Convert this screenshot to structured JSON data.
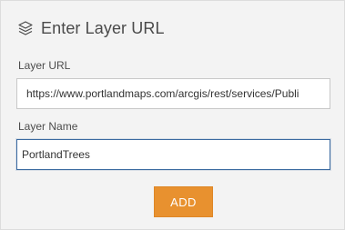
{
  "header": {
    "icon": "layers-icon",
    "title": "Enter Layer URL"
  },
  "form": {
    "url_label": "Layer URL",
    "url_value": "https://www.portlandmaps.com/arcgis/rest/services/Publi",
    "name_label": "Layer Name",
    "name_value": "PortlandTrees"
  },
  "actions": {
    "add_label": "ADD"
  },
  "colors": {
    "accent": "#e8912f",
    "focus_border": "#3b6aa0",
    "panel_background": "#f3f3f3"
  }
}
